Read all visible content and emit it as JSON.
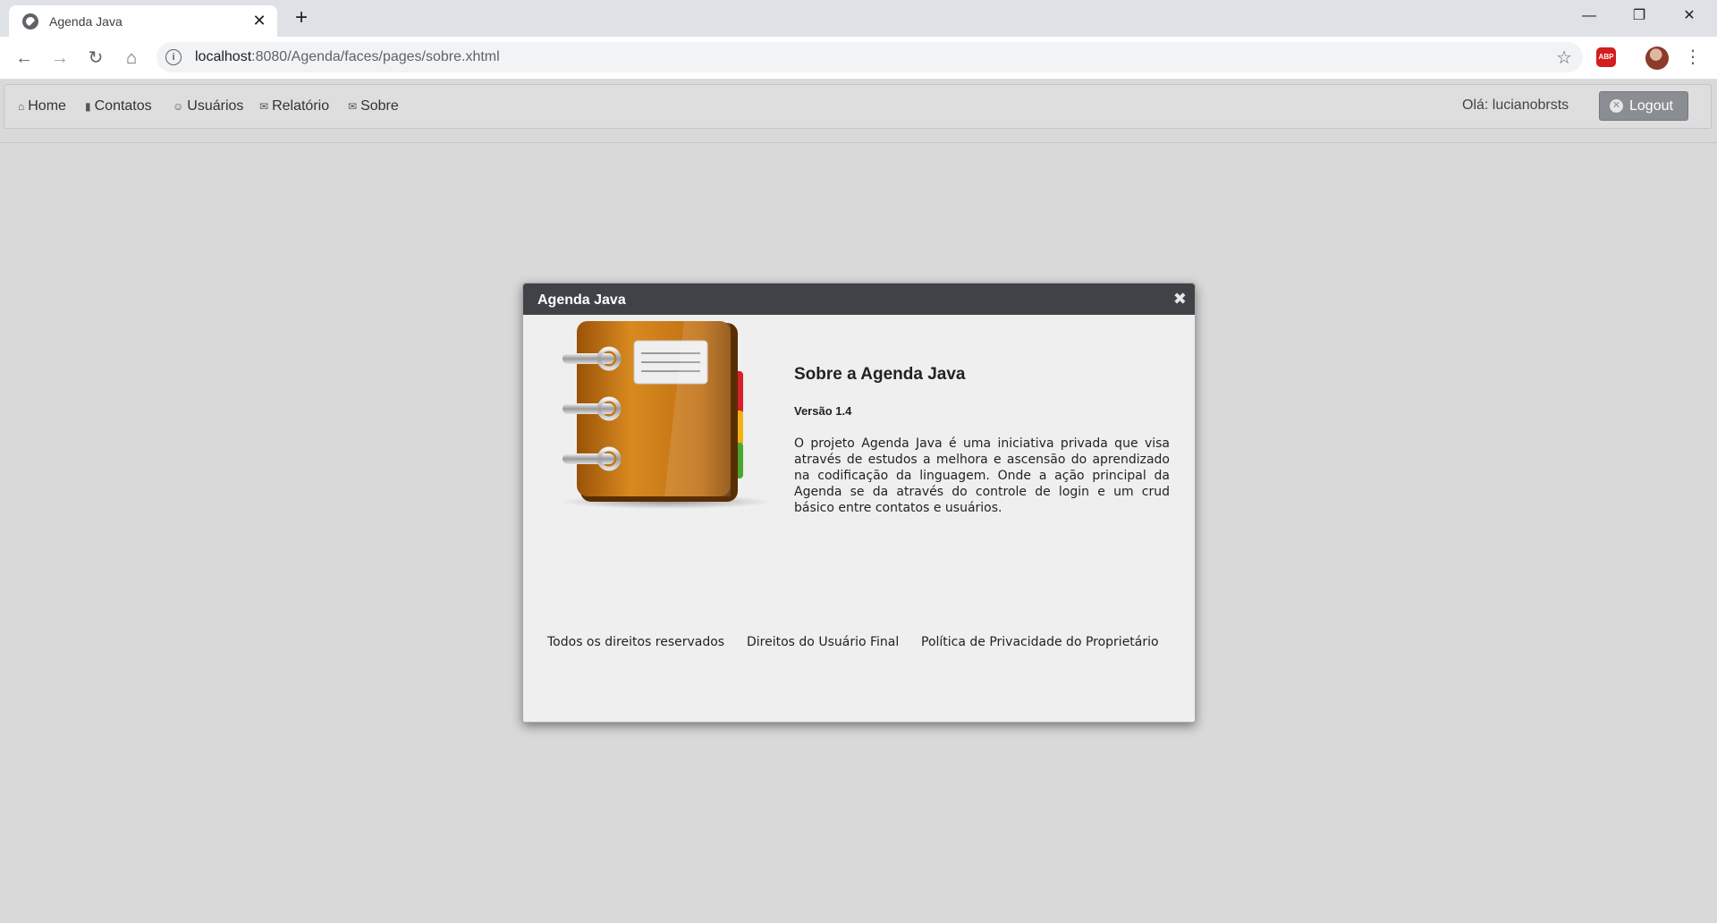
{
  "browser": {
    "tab_title": "Agenda Java",
    "url_host": "localhost",
    "url_rest": ":8080/Agenda/faces/pages/sobre.xhtml"
  },
  "menu": {
    "items": [
      {
        "label": "Home",
        "icon": "home-icon"
      },
      {
        "label": "Contatos",
        "icon": "book-icon"
      },
      {
        "label": "Usuários",
        "icon": "user-icon"
      },
      {
        "label": "Relatório",
        "icon": "comment-icon"
      },
      {
        "label": "Sobre",
        "icon": "comment-icon"
      }
    ],
    "greeting": "Olá: lucianobrsts",
    "logout_label": "Logout"
  },
  "dialog": {
    "title": "Agenda Java",
    "heading": "Sobre a Agenda Java",
    "version": "Versão 1.4",
    "description": "O projeto Agenda Java é uma iniciativa privada que visa através de estudos a melhora e ascensão do aprendizado na codificação da linguagem. Onde a ação principal da Agenda se da através do controle de login e um crud básico entre contatos e usuários.",
    "links": [
      "Todos os direitos reservados",
      "Direitos do Usuário Final",
      "Política de Privacidade do Proprietário"
    ]
  },
  "colors": {
    "dialog_header": "#3f4247",
    "page_background": "#d9d9d9",
    "logout_button": "#8a8d91"
  }
}
